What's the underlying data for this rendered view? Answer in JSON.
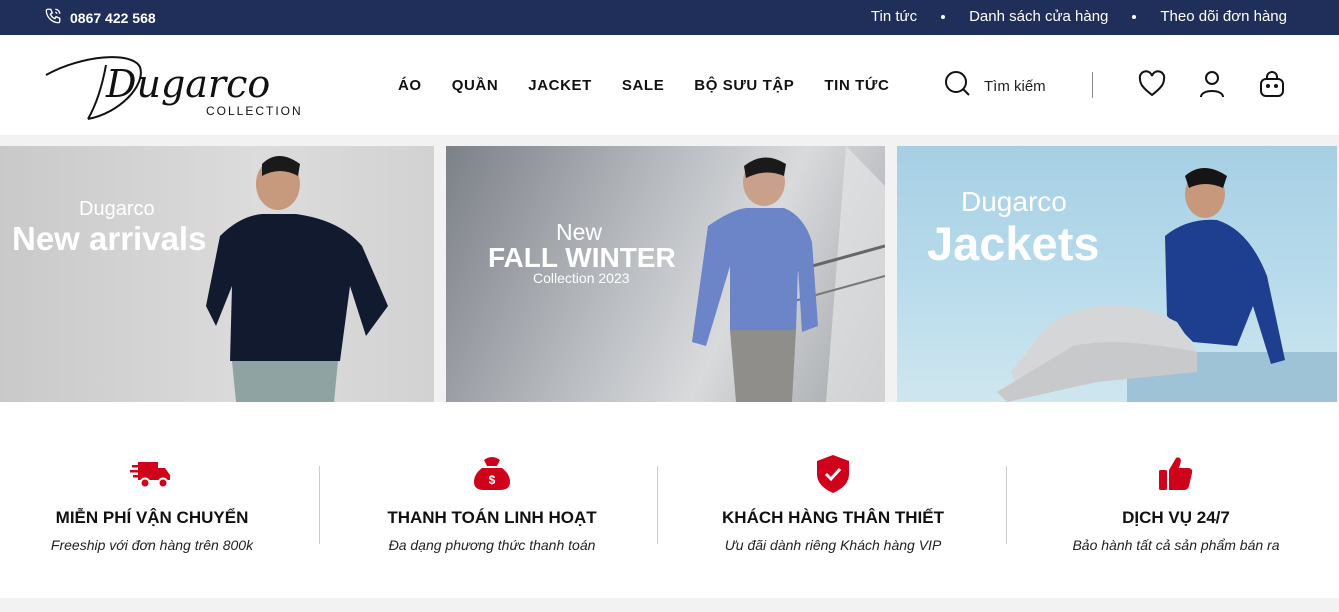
{
  "topbar": {
    "phone": "0867 422 568",
    "links": [
      "Tin tức",
      "Danh sách cửa hàng",
      "Theo dõi đơn hàng"
    ]
  },
  "header": {
    "logo_script": "Dugarco",
    "logo_sub": "COLLECTION",
    "nav": [
      "ÁO",
      "QUẦN",
      "JACKET",
      "SALE",
      "BỘ SƯU TẬP",
      "TIN TỨC"
    ],
    "search_label": "Tìm kiếm",
    "icons": [
      "search-icon",
      "heart-icon",
      "user-icon",
      "bag-icon"
    ]
  },
  "banners": [
    {
      "small": "Dugarco",
      "big": "New arrivals"
    },
    {
      "line1": "New",
      "line2": "FALL WINTER",
      "line3": "Collection 2023"
    },
    {
      "line1": "Dugarco",
      "line2": "Jackets"
    }
  ],
  "features": [
    {
      "icon": "truck-icon",
      "title": "MIỄN PHÍ VẬN CHUYỂN",
      "subtitle": "Freeship với đơn hàng trên 800k"
    },
    {
      "icon": "money-bag-icon",
      "title": "THANH TOÁN LINH HOẠT",
      "subtitle": "Đa dạng phương thức thanh toán"
    },
    {
      "icon": "shield-check-icon",
      "title": "KHÁCH HÀNG THÂN THIẾT",
      "subtitle": "Ưu đãi dành riêng Khách hàng VIP"
    },
    {
      "icon": "thumbs-up-icon",
      "title": "DỊCH VỤ 24/7",
      "subtitle": "Bảo hành tất cả sản phẩm bán ra"
    }
  ],
  "colors": {
    "topbar": "#1f2f5a",
    "accent_red": "#d0021b",
    "text": "#111111"
  }
}
